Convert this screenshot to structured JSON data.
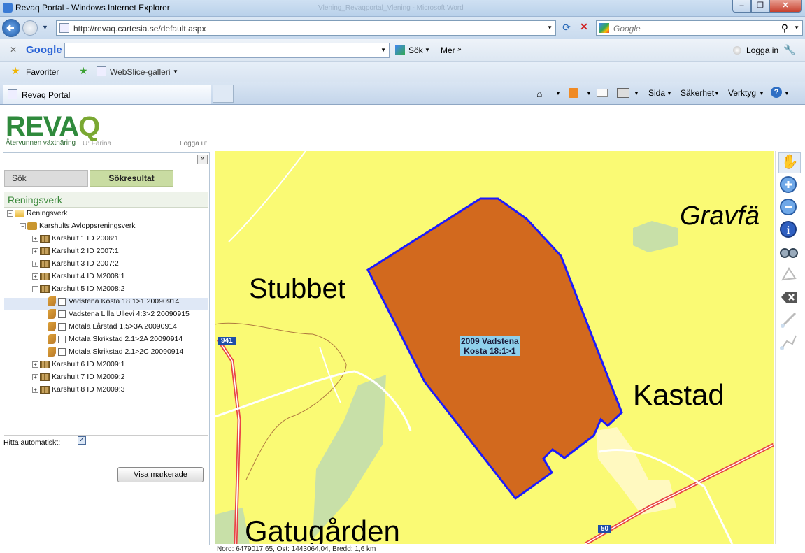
{
  "browser": {
    "window_title": "Revaq Portal - Windows Internet Explorer",
    "ghost_title": "Vlening_Revaqportal_Vlening - Microsoft Word",
    "url": "http://revaq.cartesia.se/default.aspx",
    "search_placeholder": "Google",
    "google_toolbar": {
      "brand": "Google",
      "search_label": "Sök",
      "more_label": "Mer",
      "login_label": "Logga in"
    },
    "favorites_label": "Favoriter",
    "webslice_label": "WebSlice-galleri",
    "tab_title": "Revaq Portal",
    "commands": {
      "page": "Sida",
      "security": "Säkerhet",
      "tools": "Verktyg"
    }
  },
  "app": {
    "logo_text_1": "REVA",
    "logo_text_2": "Q",
    "tagline": "Återvunnen växtnäring",
    "user": "U: Farina",
    "logout": "Logga ut",
    "tabs": {
      "search": "Sök",
      "results": "Sökresultat"
    },
    "panel_heading": "Reningsverk",
    "tree": {
      "root": "Reningsverk",
      "plant": "Karshults Avloppsreningsverk",
      "batches_before": [
        "Karshult 1 ID 2006:1",
        "Karshult 2 ID 2007:1",
        "Karshult 3 ID 2007:2",
        "Karshult 4 ID M2008:1",
        "Karshult 5 ID M2008:2"
      ],
      "fields": [
        "Vadstena Kosta 18:1>1 20090914",
        "Vadstena Lilla Ullevi 4:3>2 20090915",
        "Motala Lårstad 1.5>3A 20090914",
        "Motala Skrikstad 2.1>2A 20090914",
        "Motala Skrikstad 2.1>2C 20090914"
      ],
      "batches_after": [
        "Karshult 6 ID M2009:1",
        "Karshult 7 ID M2009:2",
        "Karshult 8 ID M2009:3"
      ]
    },
    "auto_find_label": "Hitta automatiskt:",
    "auto_find_checked": true,
    "show_selected_button": "Visa markerade"
  },
  "map": {
    "place_labels": [
      "Stubbet",
      "Kastad",
      "Gatugården",
      "Gravfä"
    ],
    "parcel_label_line1": "2009 Vadstena",
    "parcel_label_line2": "Kosta 18:1>1",
    "road_shields": [
      "941",
      "50"
    ],
    "colors": {
      "land": "#fafa74",
      "parcel_fill": "#d2691e",
      "parcel_stroke": "#1a1aff",
      "field": "#c8e0a8",
      "road": "#e84545"
    }
  },
  "status_text": "Nord: 6479017,65, Ost: 1443064,04, Bredd: 1,6 km",
  "map_tools": [
    "pan-hand-icon",
    "zoom-in-icon",
    "zoom-out-icon",
    "info-icon",
    "binoculars-icon",
    "select-polygon-icon",
    "clear-icon",
    "measure-line-icon",
    "measure-area-icon"
  ]
}
